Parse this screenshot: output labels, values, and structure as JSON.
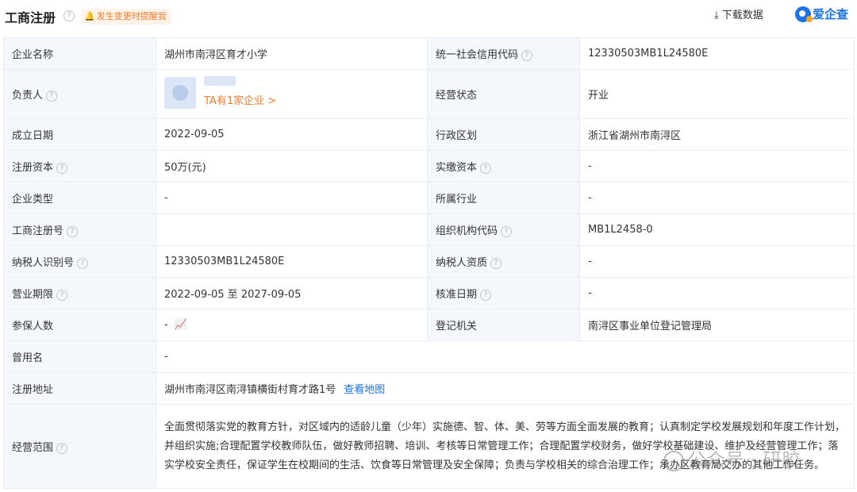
{
  "header": {
    "title": "工商注册",
    "reminder": "发生变更时提醒我",
    "download": "下载数据",
    "brand": "爱企查"
  },
  "rows": [
    {
      "l1": "企业名称",
      "v1": "湖州市南浔区育才小学",
      "l2": "统一社会信用代码",
      "v2": "12330503MB1L24580E"
    },
    {
      "l1": "负责人",
      "v1": "",
      "l2": "经营状态",
      "v2": "开业"
    },
    {
      "l1": "成立日期",
      "v1": "2022-09-05",
      "l2": "行政区划",
      "v2": "浙江省湖州市南浔区"
    },
    {
      "l1": "注册资本",
      "v1": "50万(元)",
      "l2": "实缴资本",
      "v2": "-"
    },
    {
      "l1": "企业类型",
      "v1": "-",
      "l2": "所属行业",
      "v2": "-"
    },
    {
      "l1": "工商注册号",
      "v1": "",
      "l2": "组织机构代码",
      "v2": "MB1L2458-0"
    },
    {
      "l1": "纳税人识别号",
      "v1": "12330503MB1L24580E",
      "l2": "纳税人资质",
      "v2": "-"
    },
    {
      "l1": "营业期限",
      "v1": "2022-09-05 至 2027-09-05",
      "l2": "核准日期",
      "v2": "-"
    },
    {
      "l1": "参保人数",
      "v1": "-",
      "l2": "登记机关",
      "v2": "南浔区事业单位登记管理局"
    }
  ],
  "person_link": "TA有1家企业 >",
  "former_name": {
    "label": "曾用名",
    "value": "-"
  },
  "address": {
    "label": "注册地址",
    "value": "湖州市南浔区南浔镇横街村育才路1号",
    "map_link": "查看地图"
  },
  "scope": {
    "label": "经营范围",
    "value": "全面贯彻落实党的教育方针，对区域内的适龄儿童（少年）实施德、智、体、美、劳等方面全面发展的教育；认真制定学校发展规划和年度工作计划，并组织实施;合理配置学校教师队伍，做好教师招聘、培训、考核等日常管理工作；合理配置学校财务，做好学校基础建设、维护及经营管理工作；落实学校安全责任，保证学生在校期间的生活、饮食等日常管理及安全保障；负责与学校相关的综合治理工作；承办区教育局交办的其他工作任务。"
  },
  "watermark": "公众号 · 研胶",
  "colors": {
    "accent": "#1a73e8",
    "orange": "#f07c2a",
    "label_bg": "#f4f7fc",
    "border": "#e9edf3"
  }
}
